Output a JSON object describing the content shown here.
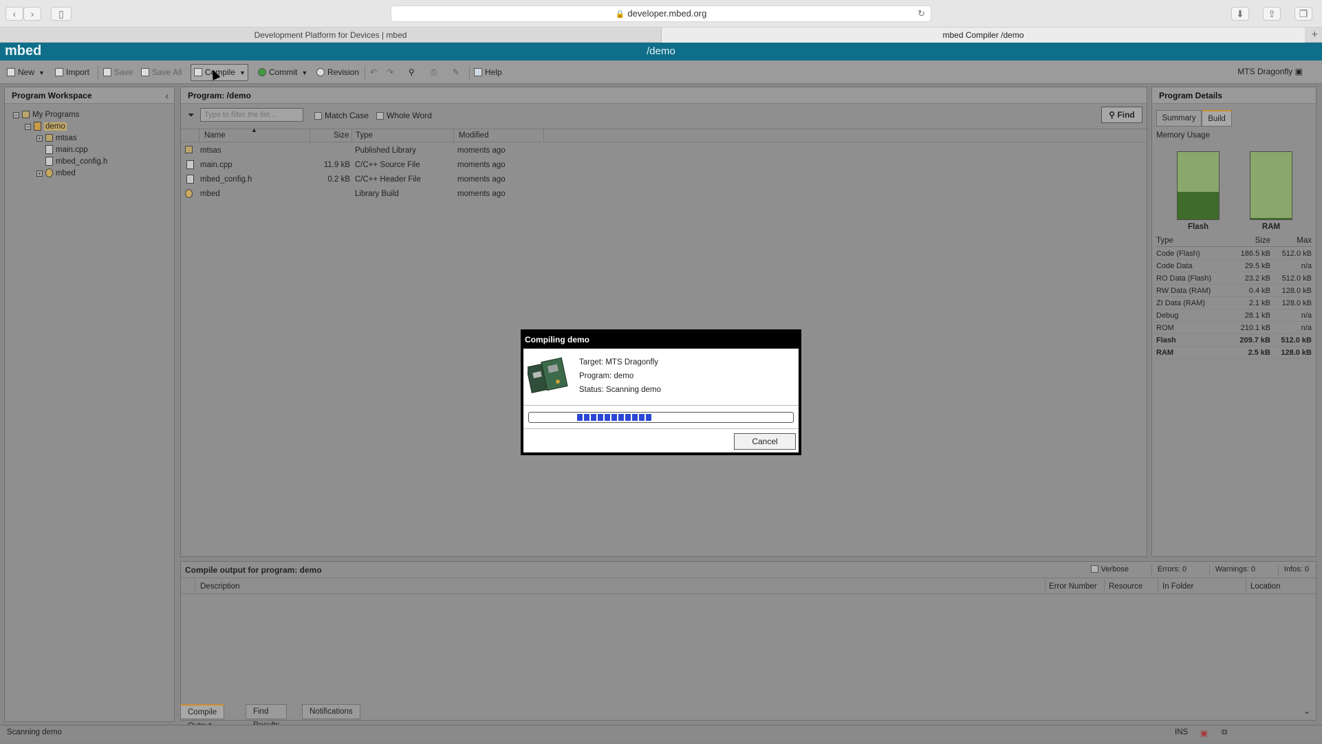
{
  "browser": {
    "url": "developer.mbed.org",
    "tabs": [
      "Development Platform for Devices | mbed",
      "mbed Compiler /demo"
    ]
  },
  "header": {
    "logo": "mbed",
    "title": "/demo"
  },
  "toolbar": {
    "new": "New",
    "import": "Import",
    "save": "Save",
    "save_all": "Save All",
    "compile": "Compile",
    "commit": "Commit",
    "revision": "Revision",
    "help": "Help",
    "target": "MTS Dragonfly"
  },
  "workspace": {
    "title": "Program Workspace",
    "tree": {
      "root": "My Programs",
      "program": "demo",
      "items": [
        "mtsas",
        "main.cpp",
        "mbed_config.h",
        "mbed"
      ]
    }
  },
  "program": {
    "title": "Program: /demo",
    "filter_placeholder": "Type to filter the list ...",
    "match_case": "Match Case",
    "whole_word": "Whole Word",
    "find": "Find",
    "columns": [
      "Name",
      "Size",
      "Type",
      "Modified"
    ],
    "rows": [
      {
        "name": "mtsas",
        "size": "",
        "type": "Published Library",
        "modified": "moments ago"
      },
      {
        "name": "main.cpp",
        "size": "11.9 kB",
        "type": "C/C++ Source File",
        "modified": "moments ago"
      },
      {
        "name": "mbed_config.h",
        "size": "0.2 kB",
        "type": "C/C++ Header File",
        "modified": "moments ago"
      },
      {
        "name": "mbed",
        "size": "",
        "type": "Library Build",
        "modified": "moments ago"
      }
    ]
  },
  "details": {
    "title": "Program Details",
    "tabs": [
      "Summary",
      "Build"
    ],
    "memory_label": "Memory Usage",
    "flash_label": "Flash",
    "ram_label": "RAM",
    "flash_fraction": 0.41,
    "ram_fraction": 0.02,
    "columns": [
      "Type",
      "Size",
      "Max"
    ],
    "rows": [
      {
        "type": "Code (Flash)",
        "size": "186.5 kB",
        "max": "512.0 kB"
      },
      {
        "type": "Code Data",
        "size": "29.5 kB",
        "max": "n/a"
      },
      {
        "type": "RO Data (Flash)",
        "size": "23.2 kB",
        "max": "512.0 kB"
      },
      {
        "type": "RW Data (RAM)",
        "size": "0.4 kB",
        "max": "128.0 kB"
      },
      {
        "type": "ZI Data (RAM)",
        "size": "2.1 kB",
        "max": "128.0 kB"
      },
      {
        "type": "Debug",
        "size": "28.1 kB",
        "max": "n/a"
      },
      {
        "type": "ROM",
        "size": "210.1 kB",
        "max": "n/a"
      },
      {
        "type": "Flash",
        "size": "209.7 kB",
        "max": "512.0 kB"
      },
      {
        "type": "RAM",
        "size": "2.5 kB",
        "max": "128.0 kB"
      }
    ]
  },
  "output": {
    "title": "Compile output for program: demo",
    "verbose": "Verbose",
    "errors": "Errors: 0",
    "warnings": "Warnings: 0",
    "infos": "Infos: 0",
    "columns": [
      "Description",
      "Error Number",
      "Resource",
      "In Folder",
      "Location"
    ],
    "tabs": [
      "Compile Output",
      "Find Results",
      "Notifications"
    ]
  },
  "status": {
    "text": "Scanning demo",
    "ins": "INS"
  },
  "dialog": {
    "title": "Compiling demo",
    "target": "Target: MTS Dragonfly",
    "program": "Program: demo",
    "status": "Status: Scanning demo",
    "cancel": "Cancel"
  }
}
